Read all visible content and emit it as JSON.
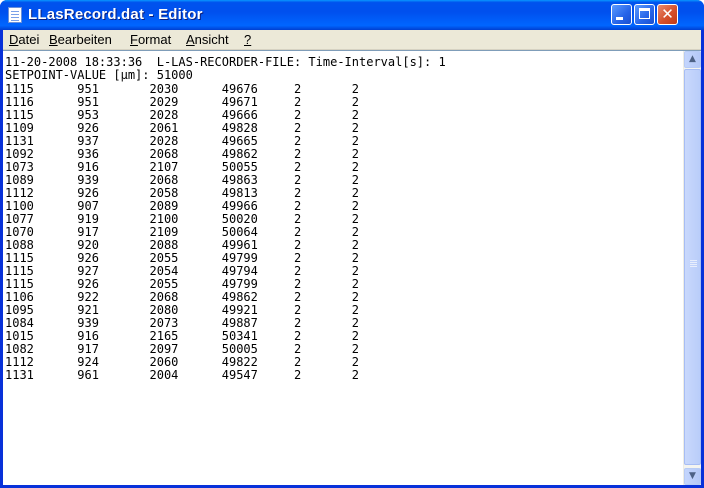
{
  "window": {
    "title": "LLasRecord.dat - Editor",
    "buttons": {
      "minimize": "",
      "maximize": "",
      "close": "✕"
    }
  },
  "menu": [
    {
      "underline": "D",
      "rest": "atei"
    },
    {
      "underline": "B",
      "rest": "earbeiten"
    },
    {
      "underline": "F",
      "rest": "ormat"
    },
    {
      "underline": "A",
      "rest": "nsicht"
    },
    {
      "underline": "?",
      "rest": ""
    }
  ],
  "document": {
    "header1": "11-20-2008 18:33:36  L-LAS-RECORDER-FILE: Time-Interval[s]: 1",
    "header2": "SETPOINT-VALUE [µm]: 51000",
    "rows": [
      [
        "1115",
        "951",
        "2030",
        "49676",
        "2",
        "2"
      ],
      [
        "1116",
        "951",
        "2029",
        "49671",
        "2",
        "2"
      ],
      [
        "1115",
        "953",
        "2028",
        "49666",
        "2",
        "2"
      ],
      [
        "1109",
        "926",
        "2061",
        "49828",
        "2",
        "2"
      ],
      [
        "1131",
        "937",
        "2028",
        "49665",
        "2",
        "2"
      ],
      [
        "1092",
        "936",
        "2068",
        "49862",
        "2",
        "2"
      ],
      [
        "1073",
        "916",
        "2107",
        "50055",
        "2",
        "2"
      ],
      [
        "1089",
        "939",
        "2068",
        "49863",
        "2",
        "2"
      ],
      [
        "1112",
        "926",
        "2058",
        "49813",
        "2",
        "2"
      ],
      [
        "1100",
        "907",
        "2089",
        "49966",
        "2",
        "2"
      ],
      [
        "1077",
        "919",
        "2100",
        "50020",
        "2",
        "2"
      ],
      [
        "1070",
        "917",
        "2109",
        "50064",
        "2",
        "2"
      ],
      [
        "1088",
        "920",
        "2088",
        "49961",
        "2",
        "2"
      ],
      [
        "1115",
        "926",
        "2055",
        "49799",
        "2",
        "2"
      ],
      [
        "1115",
        "927",
        "2054",
        "49794",
        "2",
        "2"
      ],
      [
        "1115",
        "926",
        "2055",
        "49799",
        "2",
        "2"
      ],
      [
        "1106",
        "922",
        "2068",
        "49862",
        "2",
        "2"
      ],
      [
        "1095",
        "921",
        "2080",
        "49921",
        "2",
        "2"
      ],
      [
        "1084",
        "939",
        "2073",
        "49887",
        "2",
        "2"
      ],
      [
        "1015",
        "916",
        "2165",
        "50341",
        "2",
        "2"
      ],
      [
        "1082",
        "917",
        "2097",
        "50005",
        "2",
        "2"
      ],
      [
        "1112",
        "924",
        "2060",
        "49822",
        "2",
        "2"
      ],
      [
        "1131",
        "961",
        "2004",
        "49547",
        "2",
        "2"
      ]
    ]
  },
  "scrollbar": {
    "up_arrow": "▲",
    "down_arrow": "▼"
  }
}
